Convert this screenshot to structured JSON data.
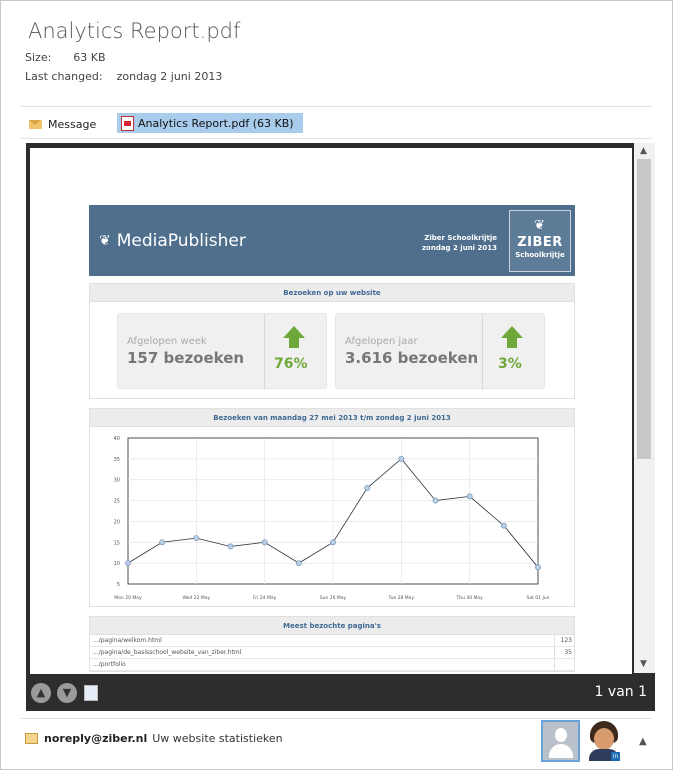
{
  "file": {
    "title": "Analytics Report.pdf",
    "size_label": "Size:",
    "size_value": "63 KB",
    "changed_label": "Last changed:",
    "changed_value": "zondag 2 juni 2013"
  },
  "attachments": {
    "message_label": "Message",
    "pdf_label": "Analytics Report.pdf (63 KB)"
  },
  "viewer": {
    "pager": "1 van 1"
  },
  "report": {
    "brand": "MediaPublisher",
    "client": "Ziber Schoolkrijtje",
    "date": "zondag 2 juni 2013",
    "logo_top": "ZIBER",
    "logo_bottom": "Schoolkrijtje",
    "section_visits": "Bezoeken op uw website",
    "kpi_week_label": "Afgelopen week",
    "kpi_week_value": "157 bezoeken",
    "kpi_week_pct": "76%",
    "kpi_year_label": "Afgelopen jaar",
    "kpi_year_value": "3.616 bezoeken",
    "kpi_year_pct": "3%",
    "section_chart": "Bezoeken van maandag 27 mei 2013 t/m zondag 2 juni 2013",
    "section_pages": "Meest bezochte pagina's",
    "pages": [
      {
        "path": ".../pagina/welkom.html",
        "count": "123"
      },
      {
        "path": ".../pagina/de_basisschool_website_van_ziber.html",
        "count": "35"
      },
      {
        "path": ".../portfolio",
        "count": ""
      }
    ]
  },
  "chart_data": {
    "type": "line",
    "x": [
      0,
      1,
      2,
      3,
      4,
      5,
      6,
      7,
      8,
      9,
      10,
      11,
      12
    ],
    "x_tick_labels": [
      "Mon 20 May",
      "Wed 22 May",
      "Fri 24 May",
      "Sun 26 May",
      "Tue 28 May",
      "Thu 30 May",
      "Sat 01 Jun"
    ],
    "x_tick_positions": [
      0,
      2,
      4,
      6,
      8,
      10,
      12
    ],
    "y": [
      10,
      15,
      16,
      14,
      15,
      10,
      15,
      28,
      35,
      25,
      26,
      19,
      9
    ],
    "ylim": [
      5,
      40
    ],
    "y_ticks": [
      5,
      10,
      15,
      20,
      25,
      30,
      35,
      40
    ],
    "grid": true
  },
  "sender": {
    "email": "noreply@ziber.nl",
    "subject": "Uw website statistieken"
  },
  "colors": {
    "header_blue": "#4f6f8d",
    "accent_green": "#6fa83a",
    "attachment_highlight": "#a9cbec"
  }
}
